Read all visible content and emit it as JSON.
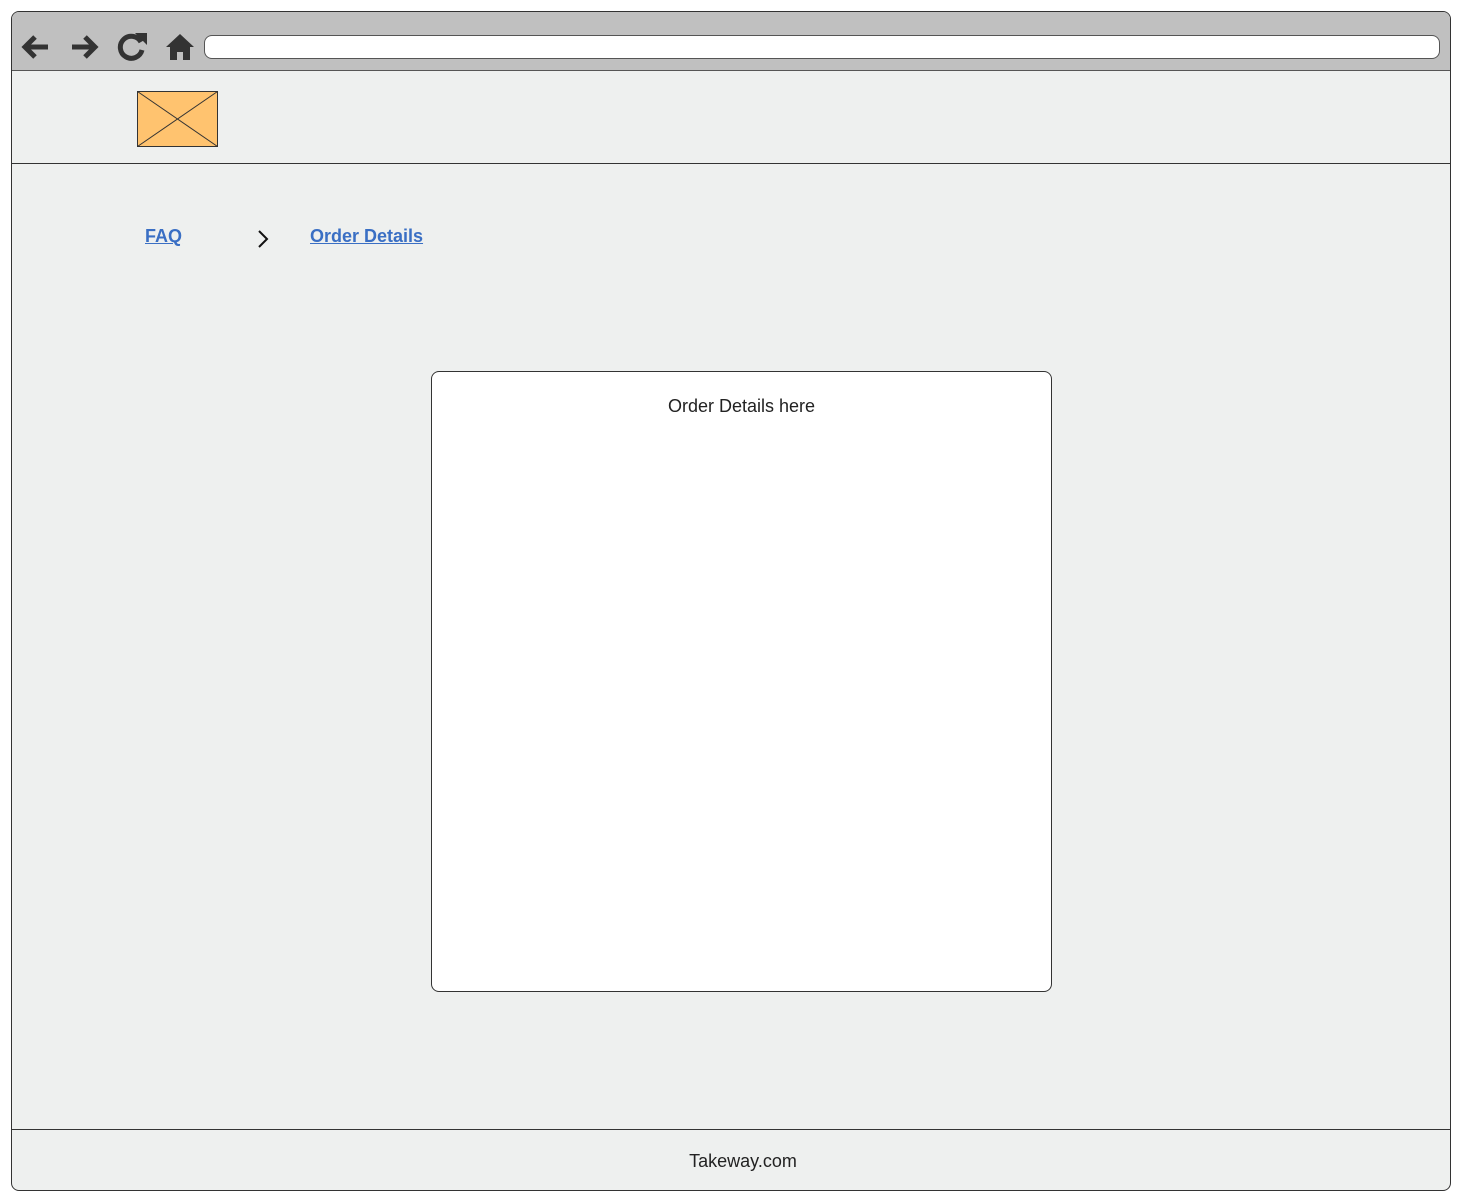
{
  "toolbar": {
    "icons": [
      "back-arrow-icon",
      "forward-arrow-icon",
      "reload-icon",
      "home-icon"
    ],
    "address_value": ""
  },
  "header": {
    "logo": "image-placeholder-icon"
  },
  "breadcrumb": {
    "items": [
      {
        "label": "FAQ"
      },
      {
        "label": "Order Details"
      }
    ],
    "separator": "chevron-right-icon"
  },
  "main": {
    "content_text": "Order Details here"
  },
  "footer": {
    "text": "Takeway.com"
  },
  "colors": {
    "toolbar_bg": "#c0c0c0",
    "page_bg": "#eef0ef",
    "link": "#3a6fc4",
    "logo_fill": "#ffc36f",
    "card_bg": "#ffffff"
  }
}
